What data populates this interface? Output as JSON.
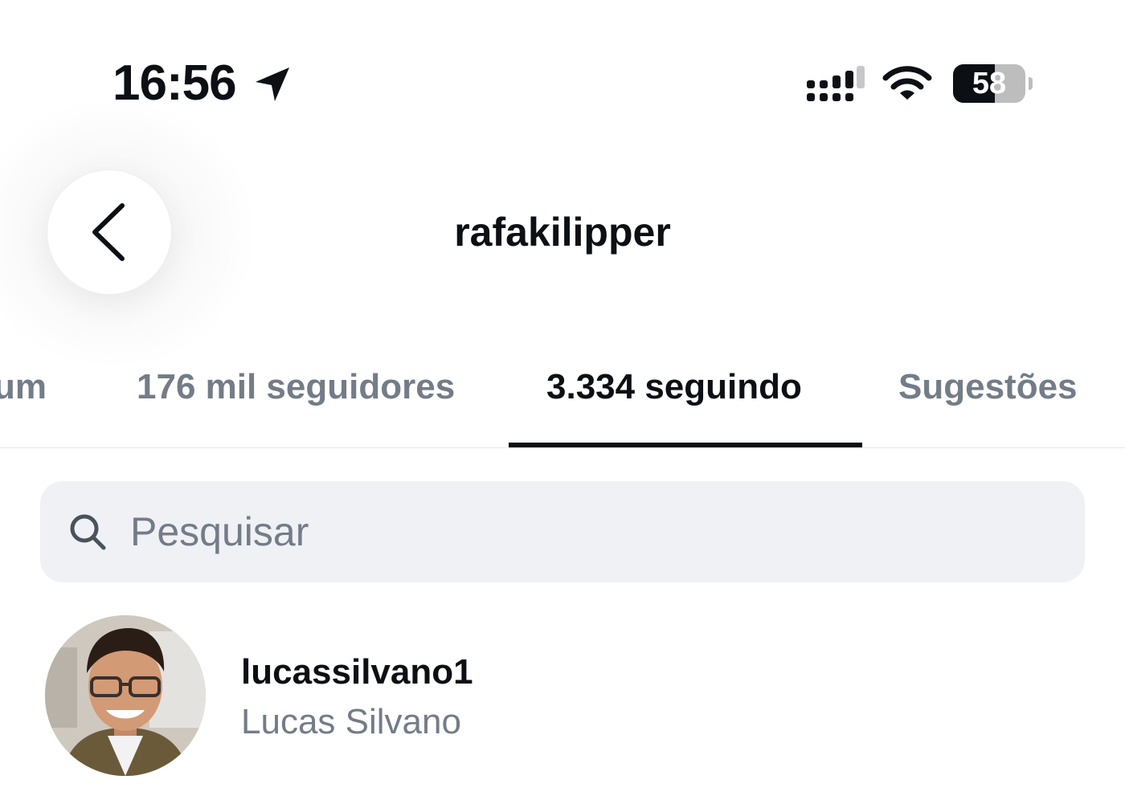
{
  "status_bar": {
    "time": "16:56",
    "battery_level": "58",
    "battery_fraction": 0.58,
    "icons": [
      "location-arrow-icon",
      "cellular-signal-icon",
      "wifi-icon",
      "battery-icon"
    ]
  },
  "header": {
    "title": "rafakilipper",
    "back_icon": "chevron-left-icon"
  },
  "tabs": [
    {
      "label": "um",
      "active": false
    },
    {
      "label": "176 mil seguidores",
      "active": false
    },
    {
      "label": "3.334 seguindo",
      "active": true
    },
    {
      "label": "Sugestões",
      "active": false
    }
  ],
  "search": {
    "placeholder": "Pesquisar",
    "value": "",
    "icon": "search-icon"
  },
  "list": [
    {
      "username": "lucassilvano1",
      "full_name": "Lucas Silvano"
    }
  ],
  "colors": {
    "text_primary": "#0c1014",
    "text_secondary": "#737c87",
    "search_background": "#eff1f5",
    "divider": "#e6e8eb"
  }
}
